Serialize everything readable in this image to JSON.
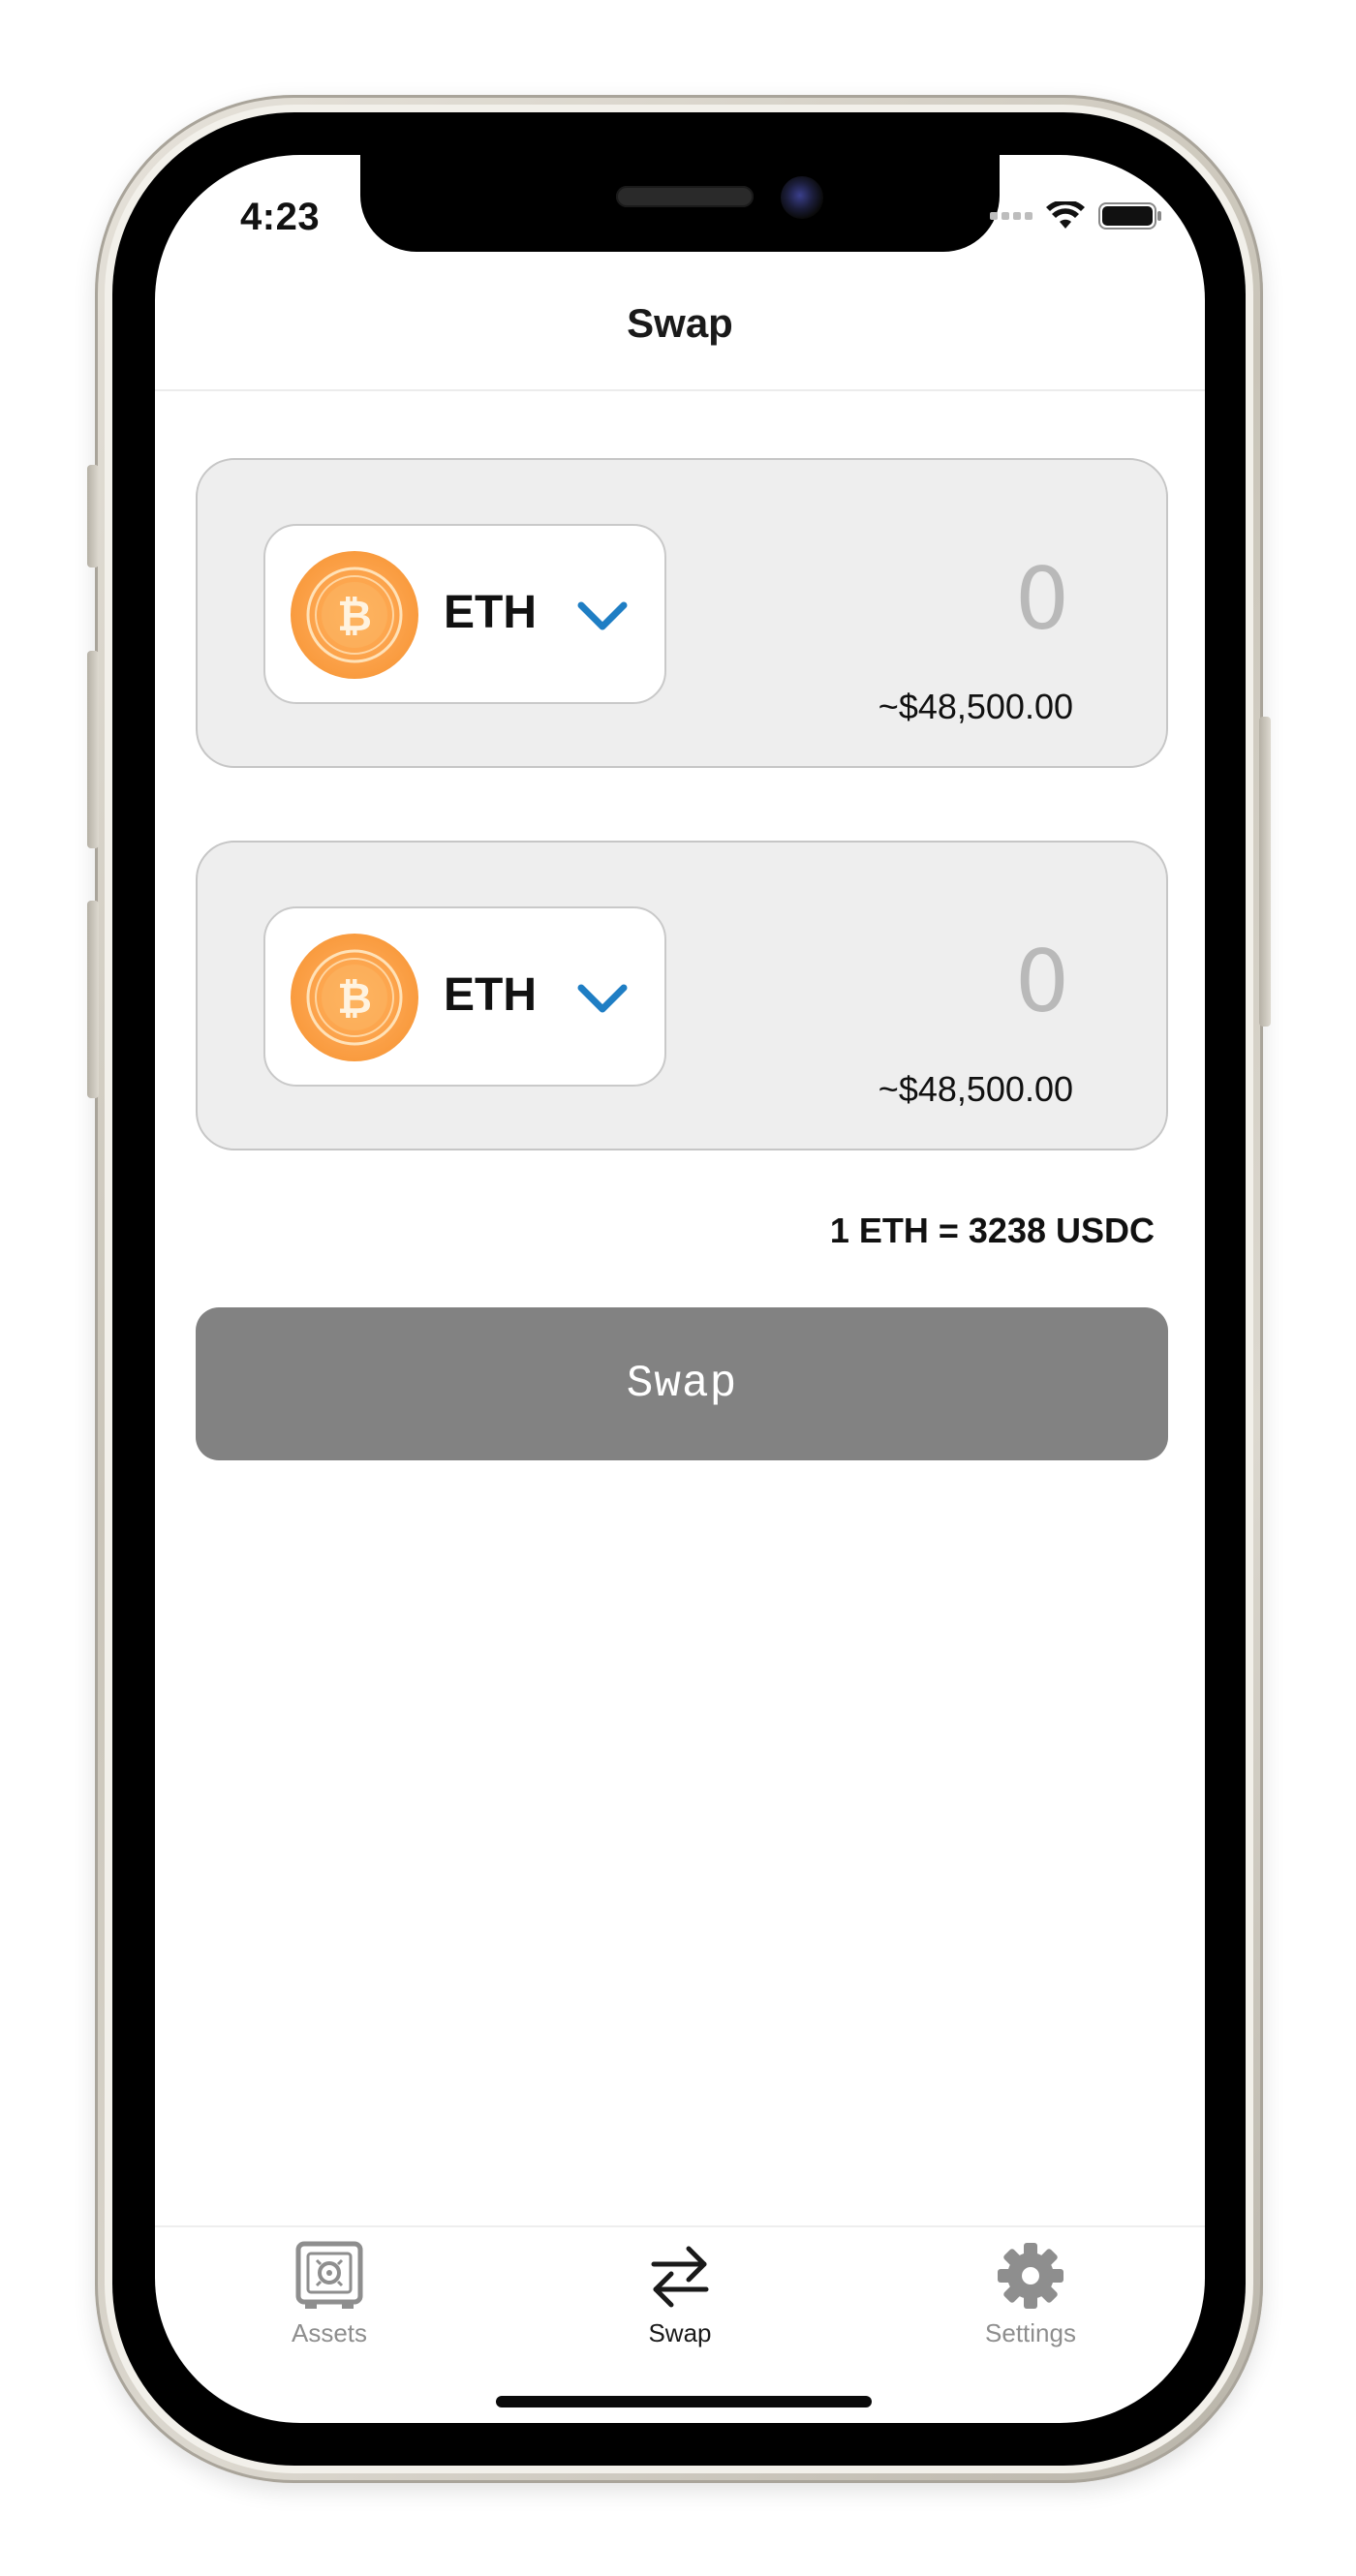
{
  "status_bar": {
    "time": "4:23"
  },
  "header": {
    "title": "Swap"
  },
  "from_card": {
    "token_icon": "bitcoin-coin-icon",
    "token_symbol": "ETH",
    "amount": "0",
    "usd_value": "~$48,500.00"
  },
  "to_card": {
    "token_icon": "bitcoin-coin-icon",
    "token_symbol": "ETH",
    "amount": "0",
    "usd_value": "~$48,500.00"
  },
  "exchange_rate": "1 ETH = 3238 USDC",
  "swap_button_label": "Swap",
  "tab_bar": {
    "tabs": [
      {
        "label": "Assets",
        "icon": "safe-icon",
        "active": false
      },
      {
        "label": "Swap",
        "icon": "swap-arrows-icon",
        "active": true
      },
      {
        "label": "Settings",
        "icon": "gear-icon",
        "active": false
      }
    ]
  },
  "colors": {
    "accent_chevron": "#1f7ec4",
    "button_background": "#828282",
    "card_background": "#eeeeee",
    "coin_orange": "#f79a3c",
    "tab_inactive": "#8e8e8e",
    "tab_active": "#1a1a1a"
  }
}
